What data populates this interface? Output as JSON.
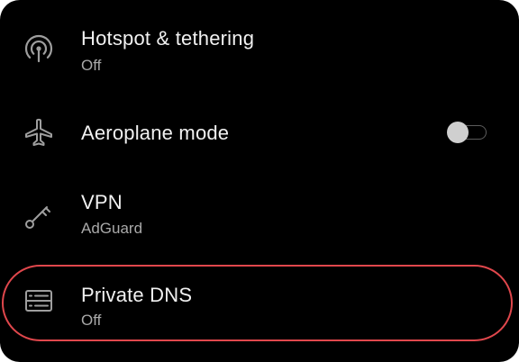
{
  "settings": {
    "items": [
      {
        "title": "Hotspot & tethering",
        "subtitle": "Off",
        "icon": "hotspot-icon"
      },
      {
        "title": "Aeroplane mode",
        "subtitle": "",
        "icon": "airplane-icon",
        "toggle": {
          "on": false
        }
      },
      {
        "title": "VPN",
        "subtitle": "AdGuard",
        "icon": "vpn-key-icon"
      },
      {
        "title": "Private DNS",
        "subtitle": "Off",
        "icon": "private-dns-icon"
      }
    ]
  },
  "colors": {
    "background": "#000000",
    "title": "#f1f1f1",
    "subtitle": "#a9a9a9",
    "icon": "#9e9e9e",
    "highlight": "#e0474c"
  }
}
